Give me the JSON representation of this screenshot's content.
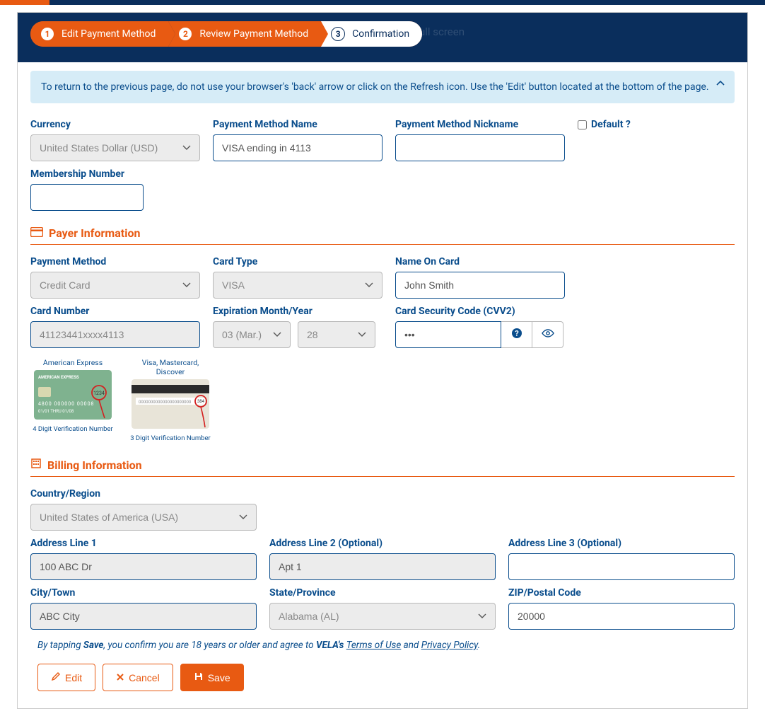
{
  "steps": [
    {
      "num": "1",
      "label": "Edit Payment Method"
    },
    {
      "num": "2",
      "label": "Review Payment Method"
    },
    {
      "num": "3",
      "label": "Confirmation"
    }
  ],
  "ghost_text": "ull screen",
  "alert": {
    "text": "To return to the previous page, do not use your browser's 'back' arrow or click on the Refresh icon. Use the 'Edit' button located at the bottom of the page."
  },
  "fields": {
    "currency": {
      "label": "Currency",
      "value": "United States Dollar (USD)"
    },
    "method_name": {
      "label": "Payment Method Name",
      "value": "VISA ending in 4113"
    },
    "nickname": {
      "label": "Payment Method Nickname",
      "value": ""
    },
    "default": {
      "label": "Default ?",
      "checked": false
    },
    "membership": {
      "label": "Membership Number",
      "value": ""
    }
  },
  "sections": {
    "payer": "Payer Information",
    "billing": "Billing Information"
  },
  "payer": {
    "payment_method": {
      "label": "Payment Method",
      "value": "Credit Card"
    },
    "card_type": {
      "label": "Card Type",
      "value": "VISA"
    },
    "name_on_card": {
      "label": "Name On Card",
      "value": "John Smith"
    },
    "card_number": {
      "label": "Card Number",
      "value": "41123441xxxx4113"
    },
    "expiration": {
      "label": "Expiration Month/Year",
      "month": "03 (Mar.)",
      "year": "28"
    },
    "cvv": {
      "label": "Card Security Code (CVV2)",
      "value": "•••"
    },
    "card_help": {
      "amex_title": "American Express",
      "amex_caption": "4 Digit Verification Number",
      "other_title": "Visa, Mastercard, Discover",
      "other_caption": "3 Digit Verification Number"
    }
  },
  "billing": {
    "country": {
      "label": "Country/Region",
      "value": "United States of America (USA)"
    },
    "addr1": {
      "label": "Address Line 1",
      "value": "100 ABC Dr"
    },
    "addr2": {
      "label": "Address Line 2 (Optional)",
      "value": "Apt 1"
    },
    "addr3": {
      "label": "Address Line 3 (Optional)",
      "value": ""
    },
    "city": {
      "label": "City/Town",
      "value": "ABC City"
    },
    "state": {
      "label": "State/Province",
      "value": "Alabama (AL)"
    },
    "zip": {
      "label": "ZIP/Postal Code",
      "value": "20000"
    }
  },
  "consent": {
    "prefix": "By tapping ",
    "save_word": "Save",
    "mid": ", you confirm you are 18 years or older and agree to ",
    "brand": "VELA's ",
    "terms": "Terms of Use",
    "and": " and ",
    "privacy": "Privacy Policy",
    "suffix": "."
  },
  "buttons": {
    "edit": "Edit",
    "cancel": "Cancel",
    "save": "Save"
  }
}
